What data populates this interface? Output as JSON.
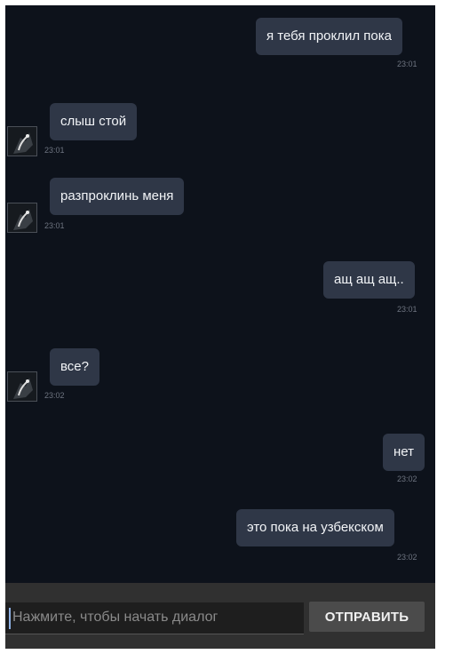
{
  "messages": [
    {
      "side": "out",
      "text": "я тебя проклил пока",
      "time": "23:01"
    },
    {
      "side": "in",
      "text": "слыш стой",
      "time": "23:01",
      "avatar": "avatar-image"
    },
    {
      "side": "in",
      "text": "разпроклинь меня",
      "time": "23:01",
      "avatar": "avatar-image"
    },
    {
      "side": "out",
      "text": "ащ ащ ащ..",
      "time": "23:01"
    },
    {
      "side": "in",
      "text": "все?",
      "time": "23:02",
      "avatar": "avatar-image"
    },
    {
      "side": "out",
      "text": "нет",
      "time": "23:02"
    },
    {
      "side": "out",
      "text": "это пока на узбекском",
      "time": "23:02"
    }
  ],
  "composer": {
    "placeholder": "Нажмите, чтобы начать диалог",
    "send_label": "ОТПРАВИТЬ"
  },
  "colors": {
    "background": "#0d121b",
    "bubble": "#2f3747",
    "time": "#6e7480"
  }
}
